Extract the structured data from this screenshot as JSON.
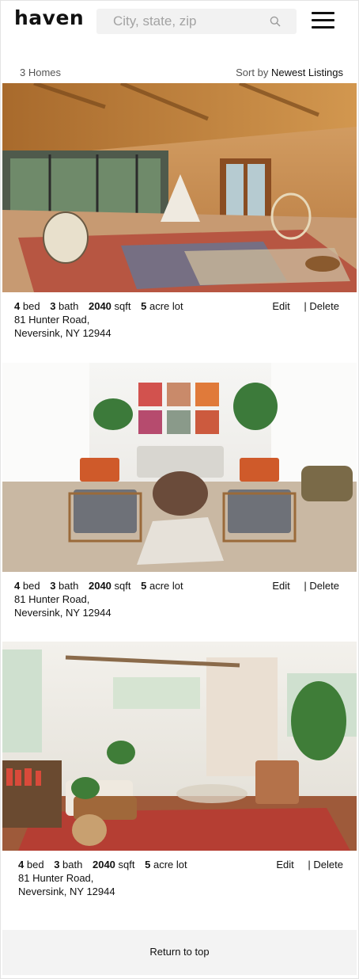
{
  "header": {
    "logo": "haven",
    "search_placeholder": "City, state, zip"
  },
  "results": {
    "count_label": "3 Homes",
    "sort_prefix": "Sort by",
    "sort_value": "Newest Listings"
  },
  "listings": [
    {
      "beds": "4",
      "beds_unit": "bed",
      "baths": "3",
      "baths_unit": "bath",
      "sqft": "2040",
      "sqft_unit": "sqft",
      "lot": "5",
      "lot_unit": "acre lot",
      "address_line1": "81 Hunter Road,",
      "address_line2": "Neversink, NY 12944",
      "edit_label": "Edit",
      "delete_label": "| Delete"
    },
    {
      "beds": "4",
      "beds_unit": "bed",
      "baths": "3",
      "baths_unit": "bath",
      "sqft": "2040",
      "sqft_unit": "sqft",
      "lot": "5",
      "lot_unit": "acre lot",
      "address_line1": "81 Hunter Road,",
      "address_line2": "Neversink, NY 12944",
      "edit_label": "Edit",
      "delete_label": "| Delete"
    },
    {
      "beds": "4",
      "beds_unit": "bed",
      "baths": "3",
      "baths_unit": "bath",
      "sqft": "2040",
      "sqft_unit": "sqft",
      "lot": "5",
      "lot_unit": "acre lot",
      "address_line1": "81 Hunter Road,",
      "address_line2": "Neversink, NY 12944",
      "edit_label": "Edit",
      "delete_label": "| Delete"
    }
  ],
  "footer": {
    "return_label": "Return to top"
  },
  "icons": {
    "search": "search-icon",
    "menu": "hamburger-menu-icon"
  },
  "colors": {
    "text": "#111111",
    "muted": "#555555",
    "search_bg": "#f2f2f2",
    "footer_bg": "#f3f3f3"
  }
}
